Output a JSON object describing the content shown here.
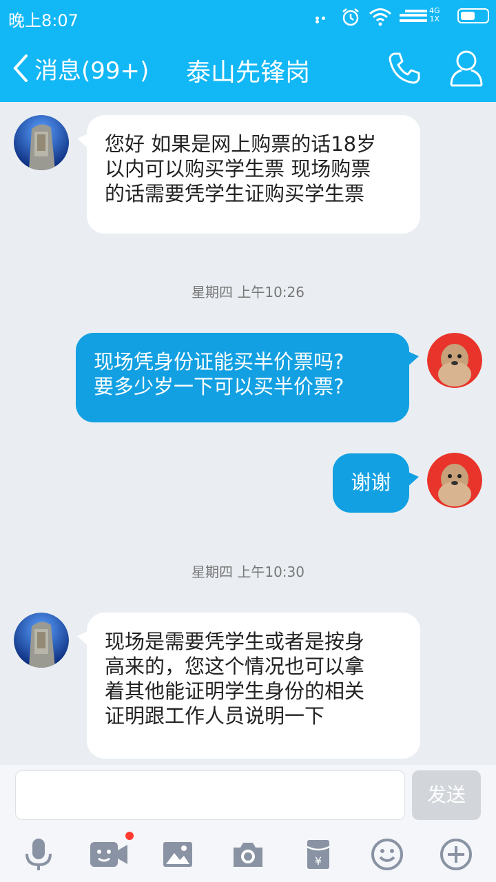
{
  "status_bar": {
    "time": "晚上8:07",
    "network_top": "4G",
    "network_bottom": "1X"
  },
  "header": {
    "back_label": "消息(99+)",
    "title": "泰山先锋岗"
  },
  "messages": [
    {
      "side": "in",
      "text_lines": [
        "您好 如果是网上购票的话18岁",
        "以内可以购买学生票 现场购票",
        "的话需要凭学生证购买学生票"
      ]
    },
    {
      "timestamp": "星期四 上午10:26"
    },
    {
      "side": "out",
      "text_lines": [
        "现场凭身份证能买半价票吗?",
        "要多少岁一下可以买半价票?"
      ]
    },
    {
      "side": "out",
      "text_lines": [
        "谢谢"
      ]
    },
    {
      "timestamp": "星期四 上午10:30"
    },
    {
      "side": "in",
      "text_lines": [
        "现场是需要凭学生或者是按身",
        "高来的，您这个情况也可以拿",
        "着其他能证明学生身份的相关",
        "证明跟工作人员说明一下"
      ]
    }
  ],
  "input": {
    "placeholder": "",
    "send_label": "发送"
  },
  "toolbar_icons": [
    "microphone-icon",
    "video-icon",
    "image-icon",
    "camera-icon",
    "red-packet-icon",
    "emoji-icon",
    "plus-icon"
  ],
  "colors": {
    "brand": "#12b7f5",
    "outgoing_bubble": "#12a0e2",
    "background": "#eaeef2",
    "notification_dot": "#ff3b30"
  }
}
